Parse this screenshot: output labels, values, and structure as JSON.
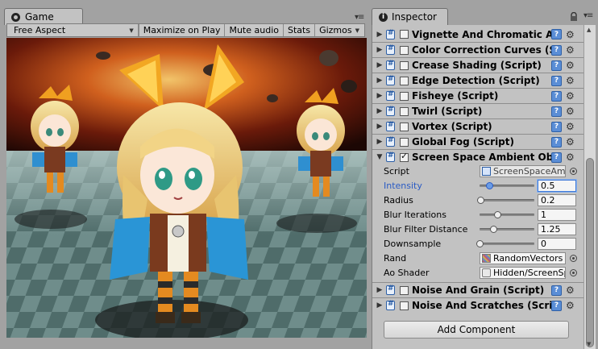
{
  "game": {
    "tab_label": "Game",
    "toolbar": {
      "aspect": "Free Aspect",
      "maximize_on_play": "Maximize on Play",
      "mute_audio": "Mute audio",
      "stats": "Stats",
      "gizmos": "Gizmos"
    }
  },
  "inspector": {
    "tab_label": "Inspector",
    "components": [
      {
        "title": "Vignette And Chromatic Aberration",
        "checked": false
      },
      {
        "title": "Color Correction Curves (Script)",
        "checked": false
      },
      {
        "title": "Crease Shading (Script)",
        "checked": false
      },
      {
        "title": "Edge Detection (Script)",
        "checked": false
      },
      {
        "title": "Fisheye (Script)",
        "checked": false
      },
      {
        "title": "Twirl (Script)",
        "checked": false
      },
      {
        "title": "Vortex (Script)",
        "checked": false
      },
      {
        "title": "Global Fog (Script)",
        "checked": false
      },
      {
        "title": "Screen Space Ambient Obscurance",
        "checked": true,
        "expanded": true
      }
    ],
    "ssao": {
      "script_label": "Script",
      "script_value": "ScreenSpaceAmbientObscurance",
      "intensity_label": "Intensity",
      "intensity_value": "0.5",
      "intensity_fraction": 0.17,
      "radius_label": "Radius",
      "radius_value": "0.2",
      "radius_fraction": 0.02,
      "blur_iter_label": "Blur Iterations",
      "blur_iter_value": "1",
      "blur_iter_fraction": 0.33,
      "blur_dist_label": "Blur Filter Distance",
      "blur_dist_value": "1.25",
      "blur_dist_fraction": 0.25,
      "downsample_label": "Downsample",
      "downsample_value": "0",
      "downsample_fraction": 0.0,
      "rand_label": "Rand",
      "rand_value": "RandomVectors",
      "ao_shader_label": "Ao Shader",
      "ao_shader_value": "Hidden/ScreenSpaceAmbientObscurance"
    },
    "components_after": [
      {
        "title": "Noise And Grain (Script)",
        "checked": false
      },
      {
        "title": "Noise And Scratches (Script)",
        "checked": false
      }
    ],
    "add_component": "Add Component"
  }
}
